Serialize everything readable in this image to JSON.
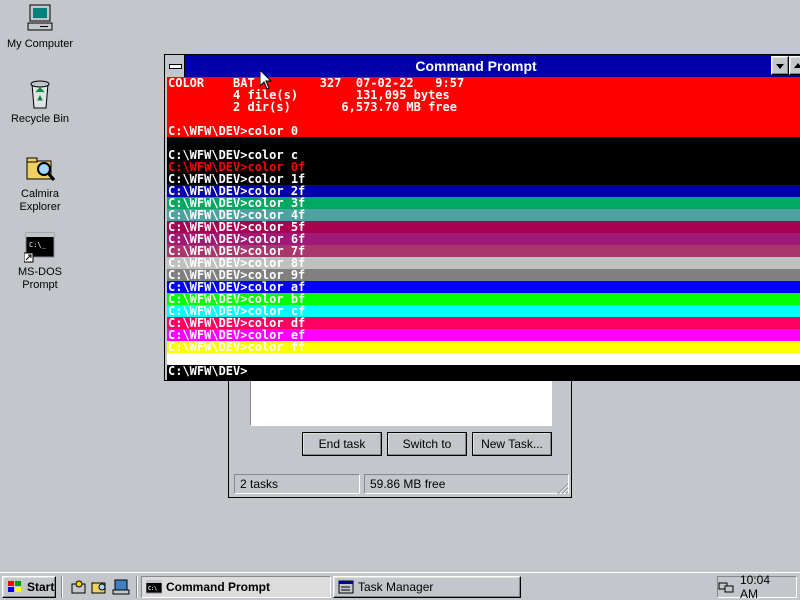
{
  "desktop": {
    "icons": [
      {
        "label": "My Computer",
        "icon": "computer-icon"
      },
      {
        "label": "Recycle Bin",
        "icon": "recycle-bin-icon"
      },
      {
        "label": "Calmira Explorer",
        "icon": "explorer-icon"
      },
      {
        "label": "MS-DOS Prompt",
        "icon": "msdos-icon"
      }
    ]
  },
  "cmd_window": {
    "title": "Command Prompt",
    "lines": [
      {
        "text": "COLOR    BAT         327  07-02-22   9:57",
        "bg": "#ff0000",
        "fg": "#ffffff"
      },
      {
        "text": "         4 file(s)        131,095 bytes",
        "bg": "#ff0000",
        "fg": "#ffffff"
      },
      {
        "text": "         2 dir(s)       6,573.70 MB free",
        "bg": "#ff0000",
        "fg": "#ffffff"
      },
      {
        "text": "",
        "bg": "#ff0000",
        "fg": "#ffffff"
      },
      {
        "text": "C:\\WFW\\DEV>color 0",
        "bg": "#ff0000",
        "fg": "#ffffff"
      },
      {
        "text": "",
        "bg": "#000000",
        "fg": "#ffffff"
      },
      {
        "text": "C:\\WFW\\DEV>color c",
        "bg": "#000000",
        "fg": "#ffffff"
      },
      {
        "text": "C:\\WFW\\DEV>color 0f",
        "bg": "#000000",
        "fg": "#ff0000"
      },
      {
        "text": "C:\\WFW\\DEV>color 1f",
        "bg": "#000000",
        "fg": "#ffffff"
      },
      {
        "text": "C:\\WFW\\DEV>color 2f",
        "bg": "#0000a8",
        "fg": "#ffffff"
      },
      {
        "text": "C:\\WFW\\DEV>color 3f",
        "bg": "#00a860",
        "fg": "#ffffff"
      },
      {
        "text": "C:\\WFW\\DEV>color 4f",
        "bg": "#4fa0a0",
        "fg": "#ffffff"
      },
      {
        "text": "C:\\WFW\\DEV>color 5f",
        "bg": "#a80050",
        "fg": "#ffffff"
      },
      {
        "text": "C:\\WFW\\DEV>color 6f",
        "bg": "#a01878",
        "fg": "#ffffff"
      },
      {
        "text": "C:\\WFW\\DEV>color 7f",
        "bg": "#a8386c",
        "fg": "#ffffff"
      },
      {
        "text": "C:\\WFW\\DEV>color 8f",
        "bg": "#c0c0c0",
        "fg": "#ffffff"
      },
      {
        "text": "C:\\WFW\\DEV>color 9f",
        "bg": "#808080",
        "fg": "#ffffff"
      },
      {
        "text": "C:\\WFW\\DEV>color af",
        "bg": "#0000ff",
        "fg": "#ffffff"
      },
      {
        "text": "C:\\WFW\\DEV>color bf",
        "bg": "#00ff00",
        "fg": "#ffffff"
      },
      {
        "text": "C:\\WFW\\DEV>color cf",
        "bg": "#00ffff",
        "fg": "#ffffff"
      },
      {
        "text": "C:\\WFW\\DEV>color df",
        "bg": "#ff0060",
        "fg": "#ffffff"
      },
      {
        "text": "C:\\WFW\\DEV>color ef",
        "bg": "#ff00ff",
        "fg": "#ffffff"
      },
      {
        "text": "C:\\WFW\\DEV>color ff",
        "bg": "#ffff00",
        "fg": "#ffffff"
      },
      {
        "text": "",
        "bg": "#ffffff",
        "fg": "#000000"
      },
      {
        "text": "C:\\WFW\\DEV>",
        "bg": "#000000",
        "fg": "#ffffff"
      }
    ]
  },
  "task_manager": {
    "buttons": {
      "end_task": "End task",
      "switch_to": "Switch to",
      "new_task": "New Task..."
    },
    "status": {
      "tasks": "2 tasks",
      "free": "59.86 MB free"
    }
  },
  "taskbar": {
    "start_label": "Start",
    "tasks": [
      {
        "label": "Command Prompt",
        "active": true
      },
      {
        "label": "Task Manager",
        "active": false
      }
    ],
    "clock": "10:04 AM"
  }
}
